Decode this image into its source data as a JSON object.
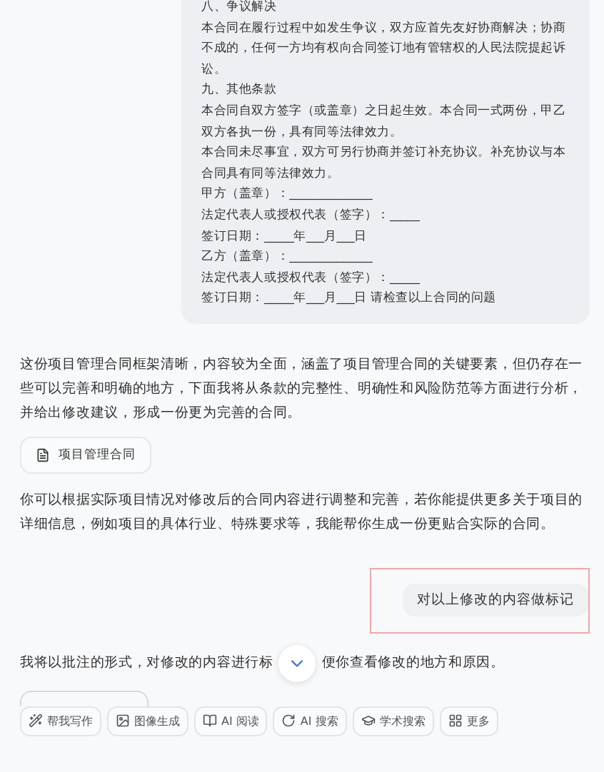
{
  "user_message_lines": [
    "八、争议解决",
    "本合同在履行过程中如发生争议，双方应首先友好协商解决；协商不成的，任何一方均有权向合同签订地有管辖权的人民法院提起诉讼。",
    "九、其他条款",
    "本合同自双方签字（或盖章）之日起生效。本合同一式两份，甲乙双方各执一份，具有同等法律效力。",
    "本合同未尽事宜，双方可另行协商并签订补充协议。补充协议与本合同具有同等法律效力。",
    "甲方（盖章）：______________",
    "法定代表人或授权代表（签字）：_____",
    "签订日期：_____年___月___日",
    "乙方（盖章）：______________",
    "法定代表人或授权代表（签字）：_____",
    "签订日期：_____年___月___日 请检查以上合同的问题"
  ],
  "assistant_intro": "这份项目管理合同框架清晰，内容较为全面，涵盖了项目管理合同的关键要素，但仍存在一些可以完善和明确的地方，下面我将从条款的完整性、明确性和风险防范等方面进行分析，并给出修改建议，形成一份更为完善的合同。",
  "attachment": {
    "label": "项目管理合同"
  },
  "assistant_outro": "你可以根据实际项目情况对修改后的合同内容进行调整和完善，若你能提供更多关于项目的详细信息，例如项目的具体行业、特殊要求等，我能帮你生成一份更贴合实际的合同。",
  "user_followup": {
    "text": "对以上修改的内容做标记",
    "highlighted": true
  },
  "reply_start": [
    "我将以批注的形式，对修改的内容进行标",
    "便你查看修改的地方和原因。"
  ],
  "toolbar": [
    {
      "label": "帮我写作",
      "kind": "write"
    },
    {
      "label": "图像生成",
      "kind": "image"
    },
    {
      "label": "AI 阅读",
      "kind": "read"
    },
    {
      "label": "AI 搜索",
      "kind": "search"
    },
    {
      "label": "学术搜索",
      "kind": "academic"
    },
    {
      "label": "更多",
      "kind": "more"
    }
  ]
}
